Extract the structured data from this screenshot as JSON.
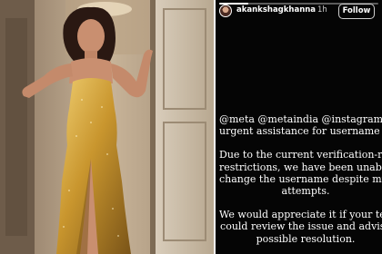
{
  "story": {
    "username": "akankshagkhanna",
    "time": "1h",
    "follow_label": "Follow",
    "progress": 0.18,
    "lines": {
      "l1": "@meta @metaindia @instagram seek",
      "l2": "urgent assistance for username chang",
      "l3": "Due to the current verification-related",
      "l4": "restrictions, we have been unable to",
      "l5": "change the username despite multiple",
      "l6": "attempts.",
      "l7": "We would appreciate it if your team",
      "l8": "could review the issue and advise",
      "l9": "possible resolution."
    }
  },
  "colors": {
    "dress": "#c9962e",
    "background": "#000000"
  }
}
